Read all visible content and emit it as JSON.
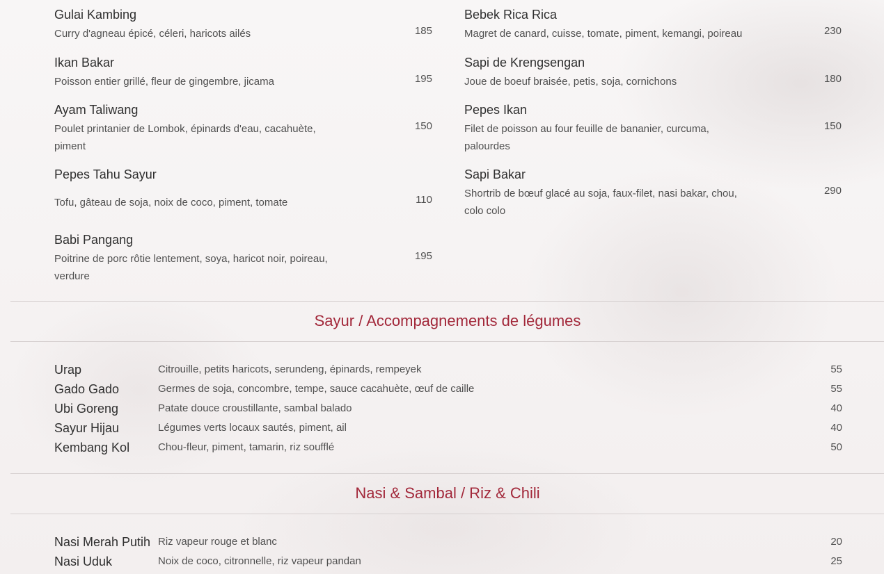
{
  "main_dishes": {
    "left": [
      {
        "name": "Gulai Kambing",
        "description": "Curry d'agneau épicé, céleri, haricots ailés",
        "price": "185"
      },
      {
        "name": "Ikan Bakar",
        "description": "Poisson entier grillé, fleur de gingembre, jicama",
        "price": "195"
      },
      {
        "name": "Ayam Taliwang",
        "description": "Poulet printanier de Lombok, épinards d'eau, cacahuète, piment",
        "price": "150"
      },
      {
        "name": "Pepes Tahu Sayur",
        "description": "Tofu, gâteau de soja, noix de coco, piment, tomate",
        "price": "110"
      },
      {
        "name": "Babi Pangang",
        "description": "Poitrine de porc rôtie lentement, soya, haricot noir, poireau, verdure",
        "price": "195"
      }
    ],
    "right": [
      {
        "name": "Bebek Rica Rica",
        "description": "Magret de canard, cuisse, tomate, piment, kemangi, poireau",
        "price": "230"
      },
      {
        "name": "Sapi de Krengsengan",
        "description": "Joue de boeuf braisée, petis, soja, cornichons",
        "price": "180"
      },
      {
        "name": "Pepes Ikan",
        "description": "Filet de poisson au four feuille de bananier, curcuma, palourdes",
        "price": "150"
      },
      {
        "name": "Sapi Bakar",
        "description": "Shortrib de bœuf glacé au soja, faux-filet, nasi bakar, chou, colo colo",
        "price": "290"
      }
    ]
  },
  "sayur": {
    "title": "Sayur / Accompagnements de légumes",
    "items": [
      {
        "name": "Urap",
        "description": "Citrouille, petits haricots, serundeng, épinards, rempeyek",
        "price": "55"
      },
      {
        "name": "Gado Gado",
        "description": "Germes de soja, concombre, tempe, sauce cacahuète, œuf de caille",
        "price": "55"
      },
      {
        "name": "Ubi Goreng",
        "description": "Patate douce croustillante, sambal balado",
        "price": "40"
      },
      {
        "name": "Sayur Hijau",
        "description": "Légumes verts locaux sautés, piment, ail",
        "price": "40"
      },
      {
        "name": "Kembang Kol",
        "description": "Chou-fleur, piment, tamarin, riz soufflé",
        "price": "50"
      }
    ]
  },
  "nasi": {
    "title": "Nasi & Sambal / Riz & Chili",
    "items": [
      {
        "name": "Nasi Merah Putih",
        "description": "Riz vapeur rouge et blanc",
        "price": "20"
      },
      {
        "name": "Nasi Uduk",
        "description": "Noix de coco, citronnelle, riz vapeur pandan",
        "price": "25"
      }
    ]
  }
}
